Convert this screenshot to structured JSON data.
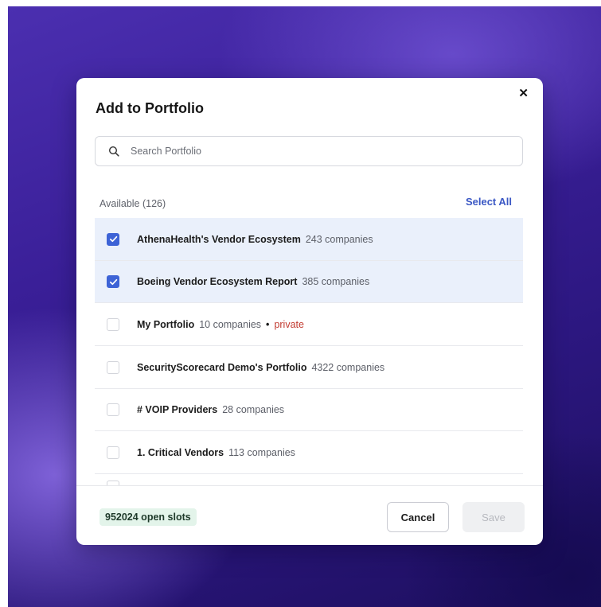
{
  "modal": {
    "title": "Add to Portfolio",
    "close_icon": "close-icon"
  },
  "search": {
    "placeholder": "Search Portfolio",
    "value": "",
    "icon": "search-icon"
  },
  "list": {
    "available_label": "Available (126)",
    "select_all_label": "Select All",
    "items": [
      {
        "name": "AthenaHealth's Vendor Ecosystem",
        "count": "243 companies",
        "checked": true
      },
      {
        "name": "Boeing Vendor Ecosystem Report",
        "count": "385 companies",
        "checked": true
      },
      {
        "name": "My Portfolio",
        "count": "10 companies",
        "separator": "•",
        "tag": "private",
        "checked": false
      },
      {
        "name": "SecurityScorecard Demo's Portfolio",
        "count": "4322 companies",
        "checked": false
      },
      {
        "name": "# VOIP Providers",
        "count": "28 companies",
        "checked": false
      },
      {
        "name": "1. Critical Vendors",
        "count": "113 companies",
        "checked": false
      }
    ]
  },
  "footer": {
    "slots_label": "952024 open slots",
    "cancel_label": "Cancel",
    "save_label": "Save"
  },
  "colors": {
    "accent": "#3d63d6",
    "selected_row": "#eaf0fb",
    "private_tag": "#c23a30",
    "slots_badge": "#e3f4ea"
  }
}
